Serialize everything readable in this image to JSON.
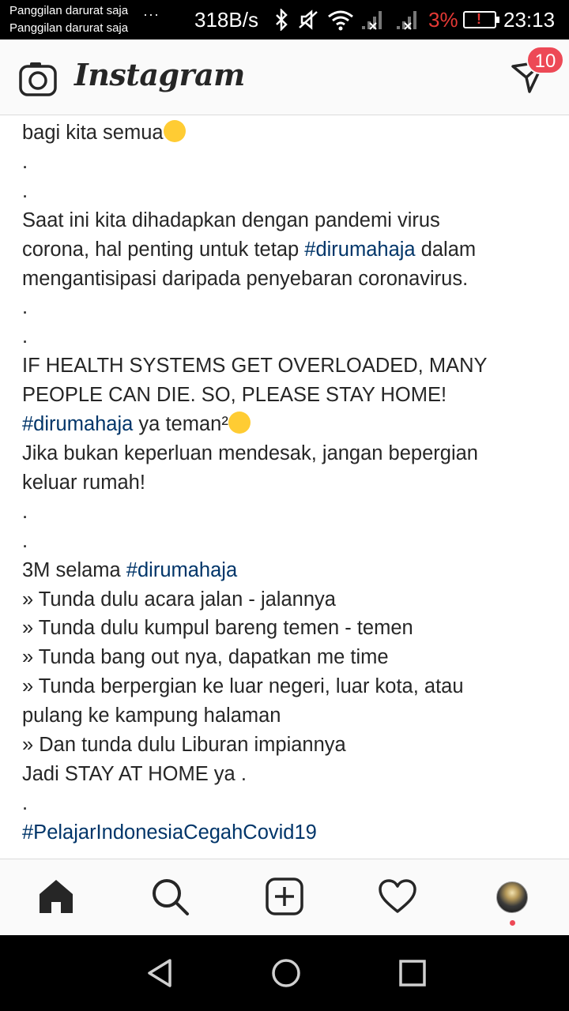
{
  "status_bar": {
    "carrier_line1": "Panggilan darurat saja",
    "carrier_line2": "Panggilan darurat saja",
    "overflow": "···",
    "net_speed": "318B/s",
    "battery_pct": "3%",
    "battery_alert": "!",
    "time": "23:13",
    "battery_color": "#e53935"
  },
  "header": {
    "brand": "Instagram",
    "notification_count": "10",
    "badge_color": "#ed4956"
  },
  "caption": {
    "hashtag_color": "#003569",
    "lines": [
      [
        "bagi kita semua",
        "emoji"
      ],
      [
        "."
      ],
      [
        "."
      ],
      [
        "Saat ini kita dihadapkan dengan pandemi virus"
      ],
      [
        "corona, hal penting untuk tetap ",
        "#dirumahaja",
        " dalam"
      ],
      [
        "mengantisipasi daripada penyebaran coronavirus."
      ],
      [
        "."
      ],
      [
        "."
      ],
      [
        "IF HEALTH SYSTEMS GET OVERLOADED, MANY"
      ],
      [
        "PEOPLE CAN DIE. SO, PLEASE STAY HOME!"
      ],
      [
        "#dirumahaja",
        " ya teman²",
        "emoji"
      ],
      [
        "Jika bukan keperluan mendesak, jangan bepergian"
      ],
      [
        "keluar rumah!"
      ],
      [
        "."
      ],
      [
        "."
      ],
      [
        "3M selama ",
        "#dirumahaja"
      ],
      [
        "» Tunda dulu acara jalan - jalannya"
      ],
      [
        "» Tunda dulu kumpul bareng temen - temen"
      ],
      [
        "» Tunda bang out nya, dapatkan me time"
      ],
      [
        "» Tunda berpergian ke luar negeri, luar kota, atau"
      ],
      [
        "pulang ke kampung halaman"
      ],
      [
        "» Dan tunda dulu Liburan impiannya"
      ],
      [
        "Jadi STAY AT HOME ya ."
      ],
      [
        "."
      ],
      [
        "#PelajarIndonesiaCegahCovid19"
      ]
    ]
  },
  "tab_bar": {
    "tabs": [
      "home-icon",
      "search-icon",
      "new-post-icon",
      "activity-heart-icon",
      "profile-avatar"
    ]
  },
  "nav_bar": {
    "buttons": [
      "back-icon",
      "home-circle-icon",
      "recents-square-icon"
    ]
  }
}
